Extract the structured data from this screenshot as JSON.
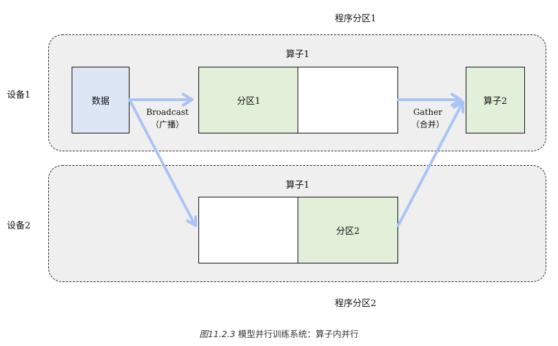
{
  "partitions": {
    "program_partition_1": "程序分区1",
    "program_partition_2": "程序分区2"
  },
  "devices": {
    "device_1": "设备1",
    "device_2": "设备2"
  },
  "operators": {
    "op1_top": "算子1",
    "op1_bottom": "算子1",
    "op2": "算子2"
  },
  "blocks": {
    "data": "数据",
    "partition_1": "分区1",
    "partition_2": "分区2"
  },
  "arrows": {
    "broadcast": "Broadcast",
    "broadcast_cn": "（广播）",
    "gather": "Gather",
    "gather_cn": "（合并）"
  },
  "caption": {
    "fig_no": "图11.2.3",
    "text": " 模型并行训练系统：算子内并行"
  },
  "colors": {
    "data_fill": "#dce6f5",
    "partition_fill": "#e2efd9",
    "region_fill": "#efefef",
    "arrow": "#a9c4f5"
  }
}
